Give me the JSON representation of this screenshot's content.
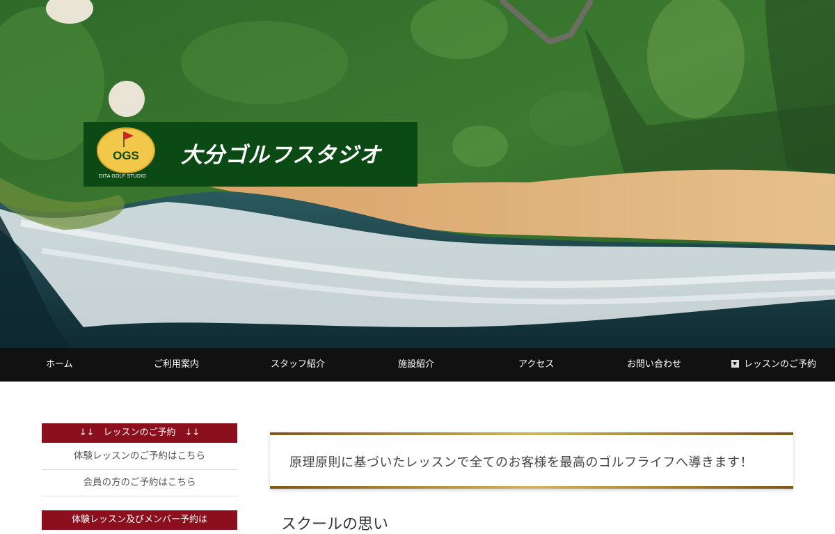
{
  "brand": {
    "logo_badge": "OGS",
    "logo_subtitle": "OITA GOLF STUDIO",
    "title": "大分ゴルフスタジオ"
  },
  "nav": {
    "items": [
      {
        "label": "ホーム"
      },
      {
        "label": "ご利用案内"
      },
      {
        "label": "スタッフ紹介"
      },
      {
        "label": "施設紹介"
      },
      {
        "label": "アクセス"
      },
      {
        "label": "お問い合わせ"
      },
      {
        "label": "レッスンのご予約",
        "icon": "caret-down-icon"
      }
    ]
  },
  "sidebar": {
    "heading1": "↓↓　レッスンのご予約　↓↓",
    "links": [
      {
        "label": "体験レッスンのご予約はこちら"
      },
      {
        "label": "会員の方のご予約はこちら"
      }
    ],
    "heading2": "体験レッスン及びメンバー予約は"
  },
  "main": {
    "banner_text": "原理原則に基づいたレッスンで全てのお客様を最高のゴルフライフへ導きます！",
    "section_title": "スクールの思い"
  },
  "colors": {
    "nav_bg": "#111111",
    "sidebar_heading_bg": "#8c0f1e",
    "logo_bg": "#0b4a14",
    "gold_accent": "#c9a74a"
  }
}
